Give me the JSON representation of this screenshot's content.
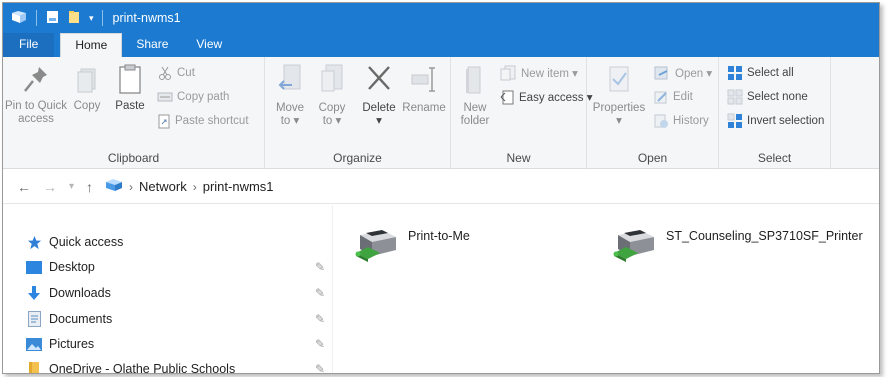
{
  "window": {
    "title": "print-nwms1"
  },
  "tabs": [
    {
      "label": "File"
    },
    {
      "label": "Home"
    },
    {
      "label": "Share"
    },
    {
      "label": "View"
    }
  ],
  "ribbon": {
    "clipboard": {
      "label": "Clipboard",
      "pin_line1": "Pin to Quick",
      "pin_line2": "access",
      "copy": "Copy",
      "paste": "Paste",
      "cut": "Cut",
      "copy_path": "Copy path",
      "paste_shortcut": "Paste shortcut"
    },
    "organize": {
      "label": "Organize",
      "move_line1": "Move",
      "move_line2": "to ▾",
      "copy_line1": "Copy",
      "copy_line2": "to ▾",
      "delete_line1": "Delete",
      "delete_line2": "▾",
      "rename": "Rename"
    },
    "new": {
      "label": "New",
      "folder_line1": "New",
      "folder_line2": "folder",
      "new_item": "New item ▾",
      "easy_access": "Easy access ▾"
    },
    "open": {
      "label": "Open",
      "properties_line1": "Properties",
      "properties_line2": "▾",
      "open": "Open ▾",
      "edit": "Edit",
      "history": "History"
    },
    "select": {
      "label": "Select",
      "select_all": "Select all",
      "select_none": "Select none",
      "invert": "Invert selection"
    }
  },
  "address": {
    "crumbs": [
      "Network",
      "print-nwms1"
    ]
  },
  "navpane": {
    "quick_access": "Quick access",
    "items": [
      {
        "label": "Desktop"
      },
      {
        "label": "Downloads"
      },
      {
        "label": "Documents"
      },
      {
        "label": "Pictures"
      },
      {
        "label": "OneDrive - Olathe Public Schools"
      }
    ]
  },
  "printers": [
    {
      "name": "Print-to-Me"
    },
    {
      "name": "ST_Counseling_SP3710SF_Printer"
    }
  ],
  "colors": {
    "titlebar": "#1c7bd0",
    "accent": "#1c7bd0"
  }
}
